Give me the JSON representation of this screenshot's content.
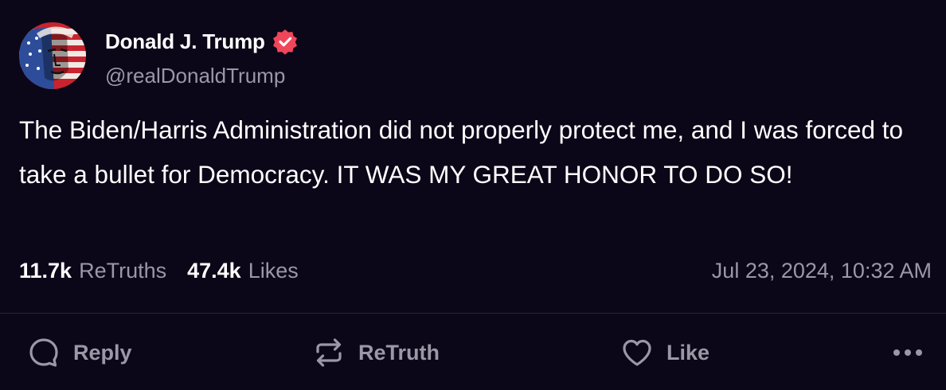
{
  "author": {
    "display_name": "Donald J. Trump",
    "handle": "@realDonaldTrump",
    "verified": true,
    "verified_badge_color": "#f0465a"
  },
  "post": {
    "text": "The Biden/Harris Administration did not properly protect me, and I was forced to take a bullet for Democracy. IT WAS MY GREAT HONOR TO DO SO!",
    "timestamp": "Jul 23, 2024, 10:32 AM"
  },
  "stats": {
    "retruths_count": "11.7k",
    "retruths_label": "ReTruths",
    "likes_count": "47.4k",
    "likes_label": "Likes"
  },
  "actions": {
    "reply_label": "Reply",
    "retruth_label": "ReTruth",
    "like_label": "Like",
    "more_icon": "more-horizontal-icon"
  },
  "theme": {
    "background": "#0c0718",
    "text_primary": "#ffffff",
    "text_secondary": "#9b97a6",
    "divider": "#2a2437"
  }
}
